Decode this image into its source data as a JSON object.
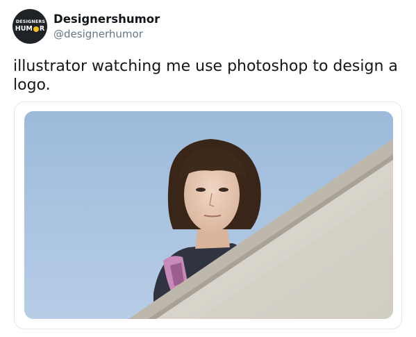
{
  "tweet": {
    "display_name": "Designershumor",
    "handle": "@designerhumor",
    "text": "illustrator watching me use photoshop to design a logo.",
    "avatar": {
      "line1": "DESIGNERS",
      "line2_left": "HUM",
      "line2_right": "R",
      "background_color": "#1f2227",
      "accent_color": "#f2c21b"
    }
  },
  "media": {
    "icon": "photo-image",
    "sky_color": "#a9c3df",
    "wall_color": "#d9d5cc"
  }
}
